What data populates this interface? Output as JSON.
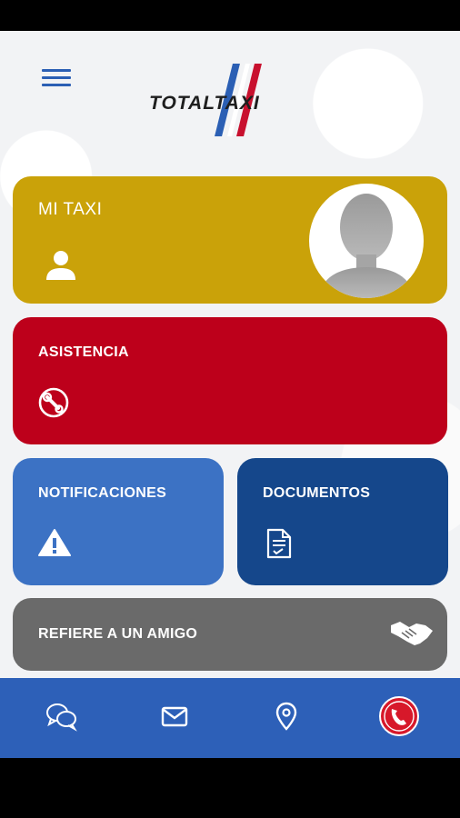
{
  "app": {
    "logo_text": "TOTALTAXI"
  },
  "header": {
    "menu_icon": "hamburger-menu-icon"
  },
  "cards": {
    "mi_taxi": {
      "label": "MI TAXI",
      "icon": "user-icon",
      "color": "#caa209"
    },
    "asistencia": {
      "label": "ASISTENCIA",
      "icon": "wrench-icon",
      "color": "#bd001b"
    },
    "notificaciones": {
      "label": "NOTIFICACIONES",
      "icon": "warning-icon",
      "color": "#3c72c4"
    },
    "documentos": {
      "label": "DOCUMENTOS",
      "icon": "document-icon",
      "color": "#15478b"
    },
    "refiere": {
      "label": "REFIERE A UN AMIGO",
      "icon": "handshake-icon",
      "color": "#6a6a6a"
    }
  },
  "bottom_nav": {
    "color": "#2d60b8",
    "items": [
      {
        "icon": "chat-icon"
      },
      {
        "icon": "mail-icon"
      },
      {
        "icon": "location-icon"
      },
      {
        "icon": "emergency-call-icon",
        "color": "#d7182a"
      }
    ]
  }
}
